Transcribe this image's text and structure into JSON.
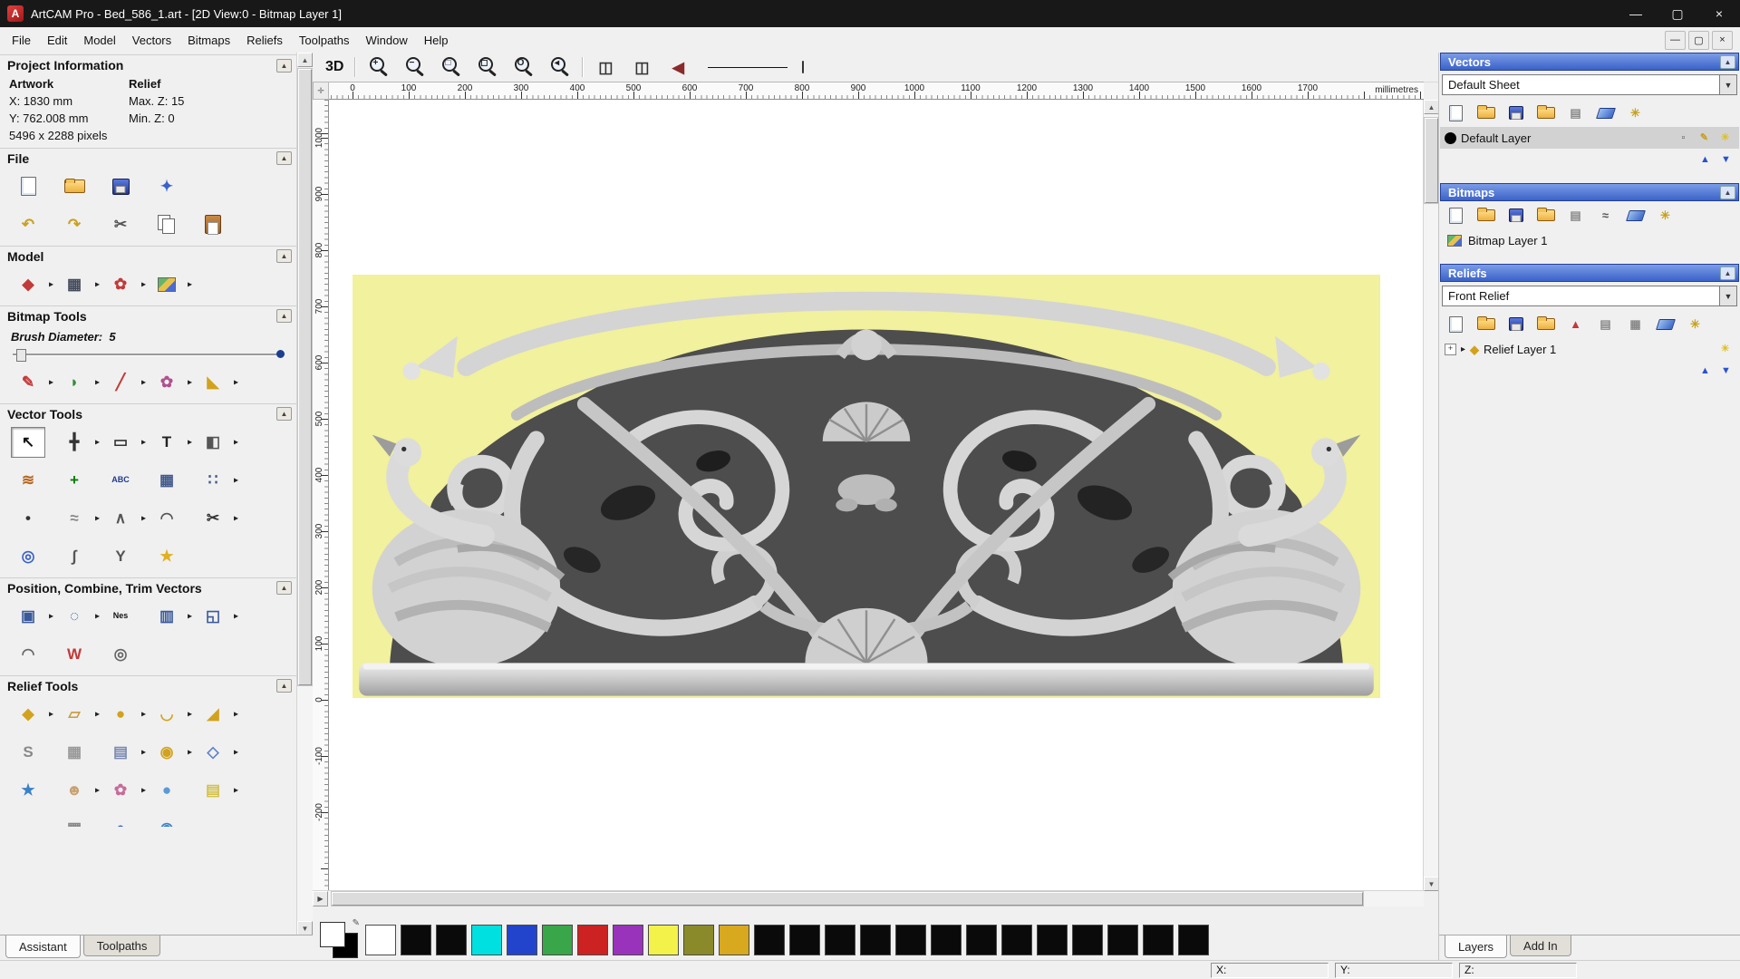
{
  "window": {
    "title": "ArtCAM Pro - Bed_586_1.art - [2D View:0 - Bitmap Layer 1]",
    "logo": "A",
    "controls": {
      "minimize": "—",
      "maximize": "▢",
      "close": "×"
    },
    "mdi": {
      "minimize": "—",
      "restore": "▢",
      "close": "×"
    }
  },
  "menu": {
    "items": [
      "File",
      "Edit",
      "Model",
      "Vectors",
      "Bitmaps",
      "Reliefs",
      "Toolpaths",
      "Window",
      "Help"
    ]
  },
  "assistant": {
    "sections": {
      "project": "Project Information",
      "file": "File",
      "model": "Model",
      "bitmap": "Bitmap Tools",
      "vector": "Vector Tools",
      "pct": "Position, Combine, Trim Vectors",
      "relief": "Relief Tools"
    },
    "project": {
      "artwork_label": "Artwork",
      "relief_label": "Relief",
      "x": "X: 1830 mm",
      "y": "Y: 762.008 mm",
      "max_z": "Max. Z: 15",
      "min_z": "Min. Z: 0",
      "pixels": "5496 x 2288 pixels"
    },
    "brush": {
      "label": "Brush Diameter:",
      "value": "5"
    },
    "file1": [
      {
        "name": "new-model",
        "kind": "page"
      },
      {
        "name": "open-model",
        "kind": "folder"
      },
      {
        "name": "save-model",
        "kind": "floppy"
      },
      {
        "name": "import-file",
        "kind": "char",
        "glyph": "✦",
        "color": "#3a62c8"
      }
    ],
    "file2": [
      {
        "name": "undo",
        "kind": "char",
        "glyph": "↶",
        "color": "#caa21e"
      },
      {
        "name": "redo",
        "kind": "char",
        "glyph": "↷",
        "color": "#caa21e"
      },
      {
        "name": "cut",
        "kind": "char",
        "glyph": "✂",
        "color": "#555555"
      },
      {
        "name": "copy",
        "kind": "copy"
      },
      {
        "name": "paste",
        "kind": "paste"
      }
    ],
    "model": [
      {
        "name": "set-model-size",
        "kind": "char",
        "glyph": "◆",
        "color": "#c23a3a",
        "arrow": true
      },
      {
        "name": "adjust-model-lighting",
        "kind": "char",
        "glyph": "▦",
        "color": "#444a5a",
        "arrow": true
      },
      {
        "name": "add-relief-clipart",
        "kind": "char",
        "glyph": "✿",
        "color": "#c23a3a",
        "arrow": true
      },
      {
        "name": "model-notes",
        "kind": "pic",
        "arrow": true
      }
    ],
    "bitmap": [
      {
        "name": "paint-brush",
        "kind": "char",
        "glyph": "✎",
        "color": "#c23a3a",
        "arrow": true
      },
      {
        "name": "paint-selective",
        "kind": "char",
        "glyph": "◗",
        "color": "#3a8a3a",
        "arrow": true
      },
      {
        "name": "draw-pixel",
        "kind": "char",
        "glyph": "╱",
        "color": "#c23a3a",
        "arrow": true
      },
      {
        "name": "colour-palette",
        "kind": "char",
        "glyph": "✿",
        "color": "#b05090",
        "arrow": true
      },
      {
        "name": "flood-fill",
        "kind": "char",
        "glyph": "◣",
        "color": "#d2a21e",
        "arrow": true
      }
    ],
    "vec1": [
      {
        "name": "select-vectors",
        "kind": "char",
        "glyph": "↖",
        "color": "#111111",
        "pressed": true
      },
      {
        "name": "transform-vectors",
        "kind": "char",
        "glyph": "╋",
        "color": "#333333",
        "arrow": true
      },
      {
        "name": "create-rectangle",
        "kind": "char",
        "glyph": "▭",
        "color": "#333333",
        "arrow": true
      },
      {
        "name": "create-text",
        "kind": "char",
        "glyph": "T",
        "color": "#222222",
        "arrow": true
      },
      {
        "name": "mirror-vectors",
        "kind": "char",
        "glyph": "◧",
        "color": "#555555",
        "arrow": true
      }
    ],
    "vec2": [
      {
        "name": "offset-vectors",
        "kind": "char",
        "glyph": "≋",
        "color": "#b5651d"
      },
      {
        "name": "paste-along-curve",
        "kind": "char",
        "glyph": "+",
        "color": "#0a7a0a"
      },
      {
        "name": "convert-text-to-vectors",
        "kind": "char",
        "glyph": "ABC",
        "color": "#223a8a"
      },
      {
        "name": "vector-grid",
        "kind": "char",
        "glyph": "▦",
        "color": "#445a8a"
      },
      {
        "name": "block-paste",
        "kind": "char",
        "glyph": "∷",
        "color": "#445a8a",
        "arrow": true
      }
    ],
    "vec3": [
      {
        "name": "create-dot",
        "kind": "char",
        "glyph": "•",
        "color": "#333333"
      },
      {
        "name": "bitmap-to-vector",
        "kind": "char",
        "glyph": "≈",
        "color": "#888888",
        "arrow": true
      },
      {
        "name": "create-polyline",
        "kind": "char",
        "glyph": "∧",
        "color": "#555555",
        "arrow": true
      },
      {
        "name": "create-arc",
        "kind": "char",
        "glyph": "◠",
        "color": "#555555"
      },
      {
        "name": "cut-trim-vectors",
        "kind": "char",
        "glyph": "✂",
        "color": "#333333",
        "arrow": true
      }
    ],
    "vec4": [
      {
        "name": "wrap-vectors",
        "kind": "char",
        "glyph": "◎",
        "color": "#3a62c8"
      },
      {
        "name": "fit-curve",
        "kind": "char",
        "glyph": "∫",
        "color": "#555555"
      },
      {
        "name": "join-vectors",
        "kind": "char",
        "glyph": "Y",
        "color": "#555555"
      },
      {
        "name": "create-star",
        "kind": "char",
        "glyph": "★",
        "color": "#e0b020"
      }
    ],
    "pct1": [
      {
        "name": "block-copy-rotate",
        "kind": "char",
        "glyph": "▣",
        "color": "#3a5a9a",
        "arrow": true
      },
      {
        "name": "circular-copy",
        "kind": "char",
        "glyph": "◌",
        "color": "#3a5a9a",
        "arrow": true
      },
      {
        "name": "nesting",
        "kind": "char",
        "glyph": "Nes",
        "color": "#111111"
      },
      {
        "name": "align-vectors",
        "kind": "char",
        "glyph": "▥",
        "color": "#3a5a9a",
        "arrow": true
      },
      {
        "name": "group-vectors",
        "kind": "char",
        "glyph": "◱",
        "color": "#3a5a9a",
        "arrow": true
      }
    ],
    "pct2": [
      {
        "name": "fit-arcs-to-curve",
        "kind": "char",
        "glyph": "◠",
        "color": "#666666"
      },
      {
        "name": "weld-vectors",
        "kind": "char",
        "glyph": "W",
        "color": "#c23a3a"
      },
      {
        "name": "create-spiral",
        "kind": "char",
        "glyph": "◎",
        "color": "#666666"
      }
    ],
    "rel1": [
      {
        "name": "shape-editor",
        "kind": "char",
        "glyph": "◆",
        "color": "#d2a21e",
        "arrow": true
      },
      {
        "name": "smooth-relief",
        "kind": "char",
        "glyph": "▱",
        "color": "#c89b3c",
        "arrow": true
      },
      {
        "name": "add-texture",
        "kind": "char",
        "glyph": "●",
        "color": "#d2a21e",
        "arrow": true
      },
      {
        "name": "two-rail-sweep",
        "kind": "char",
        "glyph": "◡",
        "color": "#d2a21e",
        "arrow": true
      },
      {
        "name": "extrude-relief",
        "kind": "char",
        "glyph": "◢",
        "color": "#d2a21e",
        "arrow": true
      }
    ],
    "rel2": [
      {
        "name": "sculpt-relief",
        "kind": "char",
        "glyph": "S",
        "color": "#888888"
      },
      {
        "name": "weave-wizard",
        "kind": "char",
        "glyph": "▦",
        "color": "#999999"
      },
      {
        "name": "relief-from-clipart",
        "kind": "char",
        "glyph": "▤",
        "color": "#7a8ab0",
        "arrow": true
      },
      {
        "name": "turn-wizard",
        "kind": "char",
        "glyph": "◉",
        "color": "#d2a21e",
        "arrow": true
      },
      {
        "name": "envelope-distort",
        "kind": "char",
        "glyph": "◇",
        "color": "#5a82c8",
        "arrow": true
      }
    ],
    "rel3": [
      {
        "name": "create-shape-star",
        "kind": "char",
        "glyph": "★",
        "color": "#3a82c8"
      },
      {
        "name": "face-wizard",
        "kind": "char",
        "glyph": "☻",
        "color": "#c8a070",
        "arrow": true
      },
      {
        "name": "texture-flow",
        "kind": "char",
        "glyph": "✿",
        "color": "#c86a9a",
        "arrow": true
      },
      {
        "name": "dome-relief",
        "kind": "char",
        "glyph": "●",
        "color": "#5a9ad8"
      },
      {
        "name": "stack-reliefs",
        "kind": "char",
        "glyph": "▤",
        "color": "#d2c24a",
        "arrow": true
      }
    ],
    "rel4": [
      {
        "name": "offset-relief",
        "kind": "char",
        "glyph": "▬",
        "color": "#c23a3a"
      },
      {
        "name": "mesh-creator",
        "kind": "char",
        "glyph": "▦",
        "color": "#888888"
      },
      {
        "name": "sphere-relief",
        "kind": "char",
        "glyph": "●",
        "color": "#3a62c8"
      },
      {
        "name": "wrap-relief",
        "kind": "char",
        "glyph": "◉",
        "color": "#3a82c8"
      }
    ],
    "tabs": [
      {
        "label": "Assistant",
        "active": true
      },
      {
        "label": "Toolpaths",
        "active": false
      }
    ]
  },
  "canvas": {
    "toolbar": {
      "view3d": "3D",
      "zoom": [
        {
          "name": "zoom-in",
          "kind": "mag",
          "glyph": "+"
        },
        {
          "name": "zoom-out",
          "kind": "mag",
          "glyph": "−"
        },
        {
          "name": "zoom-window",
          "kind": "mag",
          "glyph": "□"
        },
        {
          "name": "zoom-fit",
          "kind": "mag",
          "glyph": "◻"
        },
        {
          "name": "zoom-objects",
          "kind": "mag",
          "glyph": "O"
        },
        {
          "name": "zoom-previous",
          "kind": "mag",
          "glyph": "◂"
        }
      ],
      "aux": [
        {
          "name": "snap-view-left",
          "kind": "char",
          "glyph": "◫",
          "color": "#333333"
        },
        {
          "name": "snap-view-right",
          "kind": "char",
          "glyph": "◫",
          "color": "#333333"
        },
        {
          "name": "previous-view",
          "kind": "char",
          "glyph": "◀",
          "color": "#8a2a2a"
        }
      ]
    },
    "ruler_top": {
      "ticks": [
        "0",
        "100",
        "200",
        "300",
        "400",
        "500",
        "600",
        "700",
        "800",
        "900",
        "1000",
        "1100",
        "1200",
        "1300",
        "1400",
        "1500",
        "1600",
        "1700"
      ],
      "unit": "millimetres"
    },
    "ruler_left": {
      "ticks": [
        "1000",
        "900",
        "800",
        "700",
        "600",
        "500",
        "400",
        "300",
        "200",
        "100",
        "0",
        "-100",
        "-200"
      ]
    },
    "artwork_bg": "#f1f19e"
  },
  "layers": {
    "vectors": {
      "title": "Vectors",
      "sheet": "Default Sheet",
      "toolbar": [
        {
          "name": "new-vector-layer",
          "kind": "page"
        },
        {
          "name": "open-vector-layer",
          "kind": "folder"
        },
        {
          "name": "save-vector-layer",
          "kind": "floppy"
        },
        {
          "name": "import-vectors",
          "kind": "folder"
        },
        {
          "name": "merge-vector-layers",
          "kind": "char",
          "glyph": "▤",
          "color": "#888888"
        },
        {
          "name": "delete-vector-layer",
          "kind": "eraser"
        },
        {
          "name": "vector-layer-options",
          "kind": "char",
          "glyph": "✳",
          "color": "#c8a21e"
        }
      ],
      "layer": "Default Layer",
      "layer_icons": [
        {
          "name": "layer-lock-toggle",
          "kind": "char",
          "glyph": "▫",
          "color": "#555555"
        },
        {
          "name": "layer-edit-toggle",
          "kind": "char",
          "glyph": "✎",
          "color": "#c8a21e"
        },
        {
          "name": "layer-visibility-toggle",
          "kind": "char",
          "glyph": "☀",
          "color": "#e0c020"
        }
      ],
      "updown": [
        {
          "name": "move-vector-layer-up",
          "kind": "char",
          "glyph": "▲",
          "color": "#2a52cc"
        },
        {
          "name": "move-vector-layer-down",
          "kind": "char",
          "glyph": "▼",
          "color": "#2a52cc"
        }
      ]
    },
    "bitmaps": {
      "title": "Bitmaps",
      "toolbar": [
        {
          "name": "new-bitmap-layer",
          "kind": "page"
        },
        {
          "name": "open-bitmap-layer",
          "kind": "folder"
        },
        {
          "name": "save-bitmap-layer",
          "kind": "floppy"
        },
        {
          "name": "import-bitmap",
          "kind": "folder"
        },
        {
          "name": "merge-bitmap-layers",
          "kind": "char",
          "glyph": "▤",
          "color": "#888888"
        },
        {
          "name": "bitmap-vector-convert",
          "kind": "char",
          "glyph": "≈",
          "color": "#555555"
        },
        {
          "name": "delete-bitmap-layer",
          "kind": "eraser"
        },
        {
          "name": "bitmap-layer-options",
          "kind": "char",
          "glyph": "✳",
          "color": "#c8a21e"
        }
      ],
      "layer": "Bitmap Layer 1"
    },
    "reliefs": {
      "title": "Reliefs",
      "combo": "Front Relief",
      "toolbar": [
        {
          "name": "new-relief-layer",
          "kind": "page"
        },
        {
          "name": "open-relief-layer",
          "kind": "folder"
        },
        {
          "name": "save-relief-layer",
          "kind": "floppy"
        },
        {
          "name": "import-relief",
          "kind": "folder"
        },
        {
          "name": "calculate-relief",
          "kind": "char",
          "glyph": "▲",
          "color": "#c23a3a"
        },
        {
          "name": "relief-sheet",
          "kind": "char",
          "glyph": "▤",
          "color": "#888888"
        },
        {
          "name": "relief-grid",
          "kind": "char",
          "glyph": "▦",
          "color": "#888888"
        },
        {
          "name": "delete-relief-layer",
          "kind": "eraser"
        },
        {
          "name": "relief-layer-options",
          "kind": "char",
          "glyph": "✳",
          "color": "#c8a21e"
        }
      ],
      "layer": "Relief Layer 1",
      "layer_icon": "◆",
      "layer_icons": [
        {
          "name": "relief-layer-visibility-toggle",
          "kind": "char",
          "glyph": "☀",
          "color": "#e0c020"
        }
      ],
      "updown": [
        {
          "name": "move-relief-layer-up",
          "kind": "char",
          "glyph": "▲",
          "color": "#2a52cc"
        },
        {
          "name": "move-relief-layer-down",
          "kind": "char",
          "glyph": "▼",
          "color": "#2a52cc"
        }
      ]
    },
    "tabs": [
      {
        "label": "Layers",
        "active": true
      },
      {
        "label": "Add In",
        "active": false
      }
    ]
  },
  "palette": {
    "primary": "#ffffff",
    "secondary": "#000000",
    "colors": [
      "#ffffff",
      "#0a0a0a",
      "#0a0a0a",
      "#00e0e0",
      "#2244cc",
      "#3aa64a",
      "#cc2222",
      "#9933bb",
      "#f2f24a",
      "#8a8a2a",
      "#d8a81e",
      "#0a0a0a",
      "#0a0a0a",
      "#0a0a0a",
      "#0a0a0a",
      "#0a0a0a",
      "#0a0a0a",
      "#0a0a0a",
      "#0a0a0a",
      "#0a0a0a",
      "#0a0a0a",
      "#0a0a0a",
      "#0a0a0a",
      "#0a0a0a"
    ]
  },
  "statusbar": {
    "x_label": "X:",
    "y_label": "Y:",
    "z_label": "Z:"
  }
}
